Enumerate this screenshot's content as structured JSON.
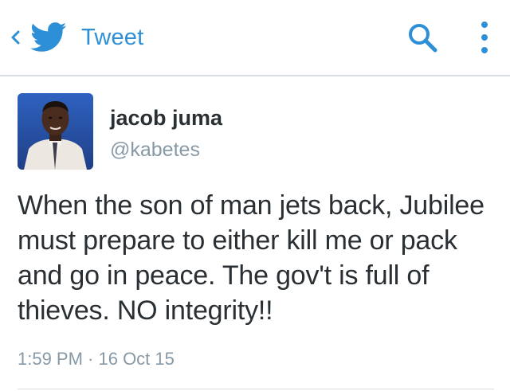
{
  "header": {
    "title": "Tweet",
    "back_icon": "chevron-left-icon",
    "logo_icon": "twitter-bird-icon",
    "search_icon": "search-icon",
    "menu_icon": "more-vertical-icon"
  },
  "tweet": {
    "author": {
      "name": "jacob juma",
      "handle": "@kabetes"
    },
    "text": "When the son of man jets back, Jubilee must prepare to either kill me or pack and go in peace. The gov't is full of thieves. NO integrity!!",
    "timestamp": "1:59 PM · 16 Oct 15"
  },
  "colors": {
    "accent": "#2d8fd6",
    "text": "#292f33",
    "muted": "#8899a6",
    "divider": "#d9dde1"
  }
}
